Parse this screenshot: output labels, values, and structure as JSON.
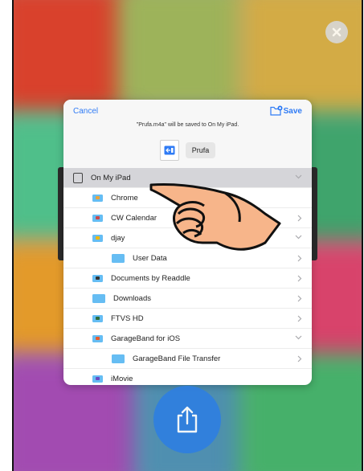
{
  "sheet": {
    "cancel_label": "Cancel",
    "save_label": "Save",
    "message": "\"Prufa.m4a\" will be saved to On My iPad.",
    "file_name": "Prufa"
  },
  "list": [
    {
      "label": "On My iPad",
      "level": 0,
      "chevron": "down",
      "icon": "ipad-icon",
      "selected": true
    },
    {
      "label": "Chrome",
      "level": 1,
      "chevron": "",
      "icon": "chrome-folder-icon",
      "badge": "#e9a33b"
    },
    {
      "label": "CW Calendar",
      "level": 1,
      "chevron": "right",
      "icon": "cw-calendar-folder-icon",
      "badge": "#c84a4a"
    },
    {
      "label": "djay",
      "level": 1,
      "chevron": "down",
      "icon": "djay-folder-icon",
      "badge": "#f0b400"
    },
    {
      "label": "User Data",
      "level": 2,
      "chevron": "right",
      "icon": "folder-icon"
    },
    {
      "label": "Documents by Readdle",
      "level": 1,
      "chevron": "right",
      "icon": "documents-folder-icon",
      "badge": "#333333"
    },
    {
      "label": "Downloads",
      "level": 1,
      "chevron": "right",
      "icon": "folder-icon"
    },
    {
      "label": "FTVS HD",
      "level": 1,
      "chevron": "right",
      "icon": "ftvs-folder-icon",
      "badge": "#2f6d3a"
    },
    {
      "label": "GarageBand for iOS",
      "level": 1,
      "chevron": "down",
      "icon": "garageband-folder-icon",
      "badge": "#e85a2a"
    },
    {
      "label": "GarageBand File Transfer",
      "level": 2,
      "chevron": "right",
      "icon": "folder-icon"
    },
    {
      "label": "iMovie",
      "level": 1,
      "chevron": "",
      "icon": "imovie-folder-icon",
      "badge": "#6a4bc4"
    }
  ],
  "colors": {
    "accent": "#2f7bf5",
    "folder": "#66bdf3",
    "share_button": "#2f7fe0",
    "selected_row": "#d5d5d9"
  },
  "icons": {
    "close": "close-icon",
    "new_folder": "new-folder-icon",
    "share": "share-icon",
    "pointer": "pointing-hand-icon"
  }
}
